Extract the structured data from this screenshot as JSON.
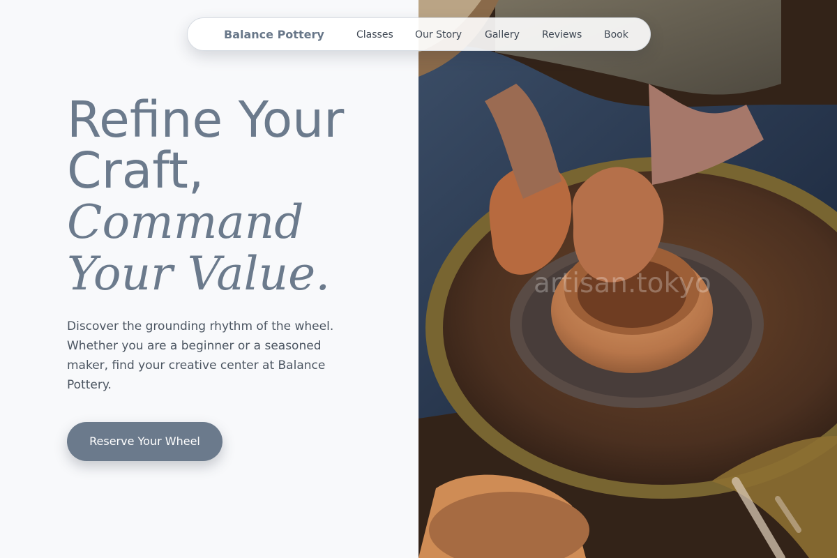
{
  "nav": {
    "brand": "Balance Pottery",
    "items": [
      "Classes",
      "Our Story",
      "Gallery",
      "Reviews",
      "Book"
    ]
  },
  "hero": {
    "headline": [
      "Refine Your",
      "Craft,",
      "Command",
      "Your Value."
    ],
    "description": "Discover the grounding rhythm of the wheel. Whether you are a beginner or a seasoned maker, find your creative center at Balance Pottery.",
    "cta_label": "Reserve Your Wheel"
  },
  "photo": {
    "watermark": "artisan.tokyo",
    "subject": "potter-hands-on-wheel"
  },
  "colors": {
    "accent": "#6b7a8c",
    "background": "#f8f9fb"
  }
}
